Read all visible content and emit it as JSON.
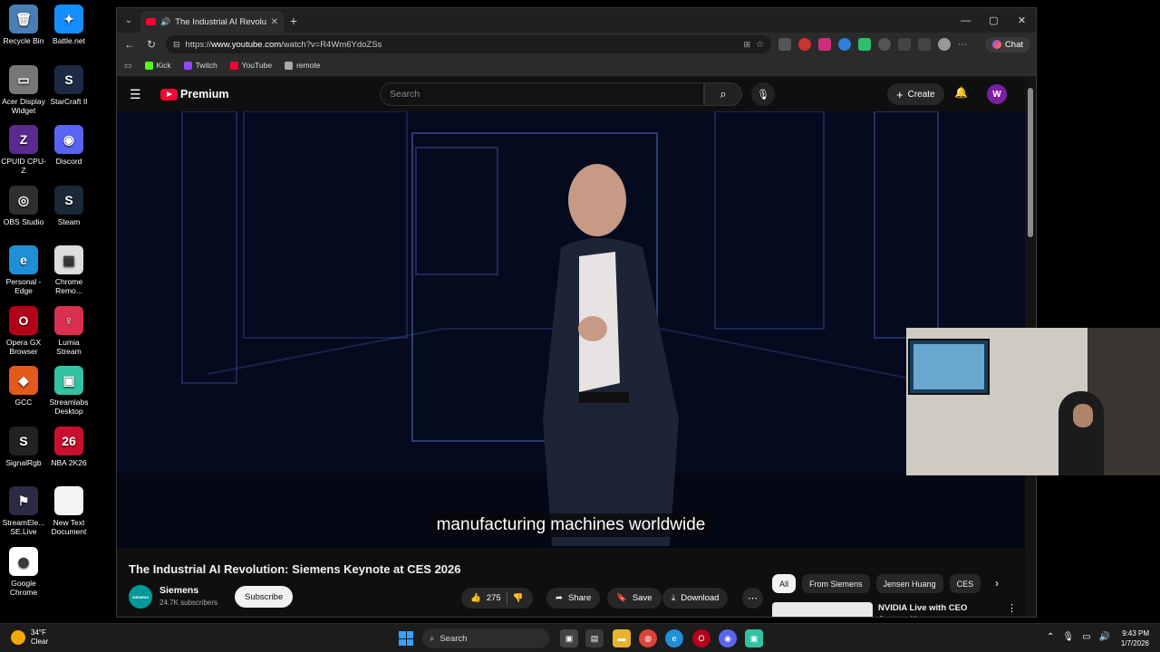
{
  "desktop": {
    "icons": [
      {
        "label": "Recycle Bin",
        "color": "#4a7fb5",
        "glyph": "🗑"
      },
      {
        "label": "Battle.net",
        "color": "#148eff",
        "glyph": "✦"
      },
      {
        "label": "Acer Display Widget",
        "color": "#777777",
        "glyph": "▭"
      },
      {
        "label": "StarCraft II",
        "color": "#1c2a44",
        "glyph": "S"
      },
      {
        "label": "CPUID CPU-Z",
        "color": "#5b2a8e",
        "glyph": "Z"
      },
      {
        "label": "Discord",
        "color": "#5865f2",
        "glyph": "◉"
      },
      {
        "label": "OBS Studio",
        "color": "#302e31",
        "glyph": "◎"
      },
      {
        "label": "Steam",
        "color": "#1b2838",
        "glyph": "S"
      },
      {
        "label": "Personal - Edge",
        "color": "#1f8fd6",
        "glyph": "e"
      },
      {
        "label": "Chrome Remo...",
        "color": "#dddddd",
        "glyph": "▣"
      },
      {
        "label": "Opera GX Browser",
        "color": "#b3001b",
        "glyph": "O"
      },
      {
        "label": "Lumia Stream",
        "color": "#d9304f",
        "glyph": "♀"
      },
      {
        "label": "GCC",
        "color": "#e45a1c",
        "glyph": "◆"
      },
      {
        "label": "Streamlabs Desktop",
        "color": "#31c3a2",
        "glyph": "▣"
      },
      {
        "label": "SignalRgb",
        "color": "#222222",
        "glyph": "S"
      },
      {
        "label": "NBA 2K26",
        "color": "#c8102e",
        "glyph": "26"
      },
      {
        "label": "StreamEle... SE.Live",
        "color": "#2b2b44",
        "glyph": "⚑"
      },
      {
        "label": "New Text Document",
        "color": "#f4f4f4",
        "glyph": ""
      },
      {
        "label": "Google Chrome",
        "color": "#ffffff",
        "glyph": "◍"
      }
    ]
  },
  "browser": {
    "tab_title": "The Industrial AI Revolution: S",
    "new_tab": "+",
    "url_prefix": "https://",
    "url_domain": "www.youtube.com",
    "url_path": "/watch?v=R4Wm6YdoZSs",
    "chat_label": "Chat",
    "bookmarks": [
      {
        "label": "Kick",
        "color": "#53fc18"
      },
      {
        "label": "Twitch",
        "color": "#9146ff"
      },
      {
        "label": "YouTube",
        "color": "#ff0033"
      },
      {
        "label": "remote",
        "color": "#aaaaaa"
      }
    ]
  },
  "youtube": {
    "logo_text": "Premium",
    "search_placeholder": "Search",
    "create_label": "Create",
    "avatar_letter": "W",
    "subtitle": "manufacturing machines worldwide",
    "video_title": "The Industrial AI Revolution: Siemens Keynote at CES 2026",
    "channel_name": "Siemens",
    "channel_logo_text": "SIEMENS",
    "subscriber_count": "24.7K subscribers",
    "subscribe_label": "Subscribe",
    "like_count": "275",
    "share_label": "Share",
    "save_label": "Save",
    "download_label": "Download",
    "chips": [
      "All",
      "From Siemens",
      "Jensen Huang",
      "CES"
    ],
    "rec_title": "NVIDIA Live with CEO Jensen Huang"
  },
  "taskbar": {
    "temperature": "34°F",
    "condition": "Clear",
    "search_label": "Search",
    "time": "9:43 PM",
    "date": "1/7/2026"
  }
}
